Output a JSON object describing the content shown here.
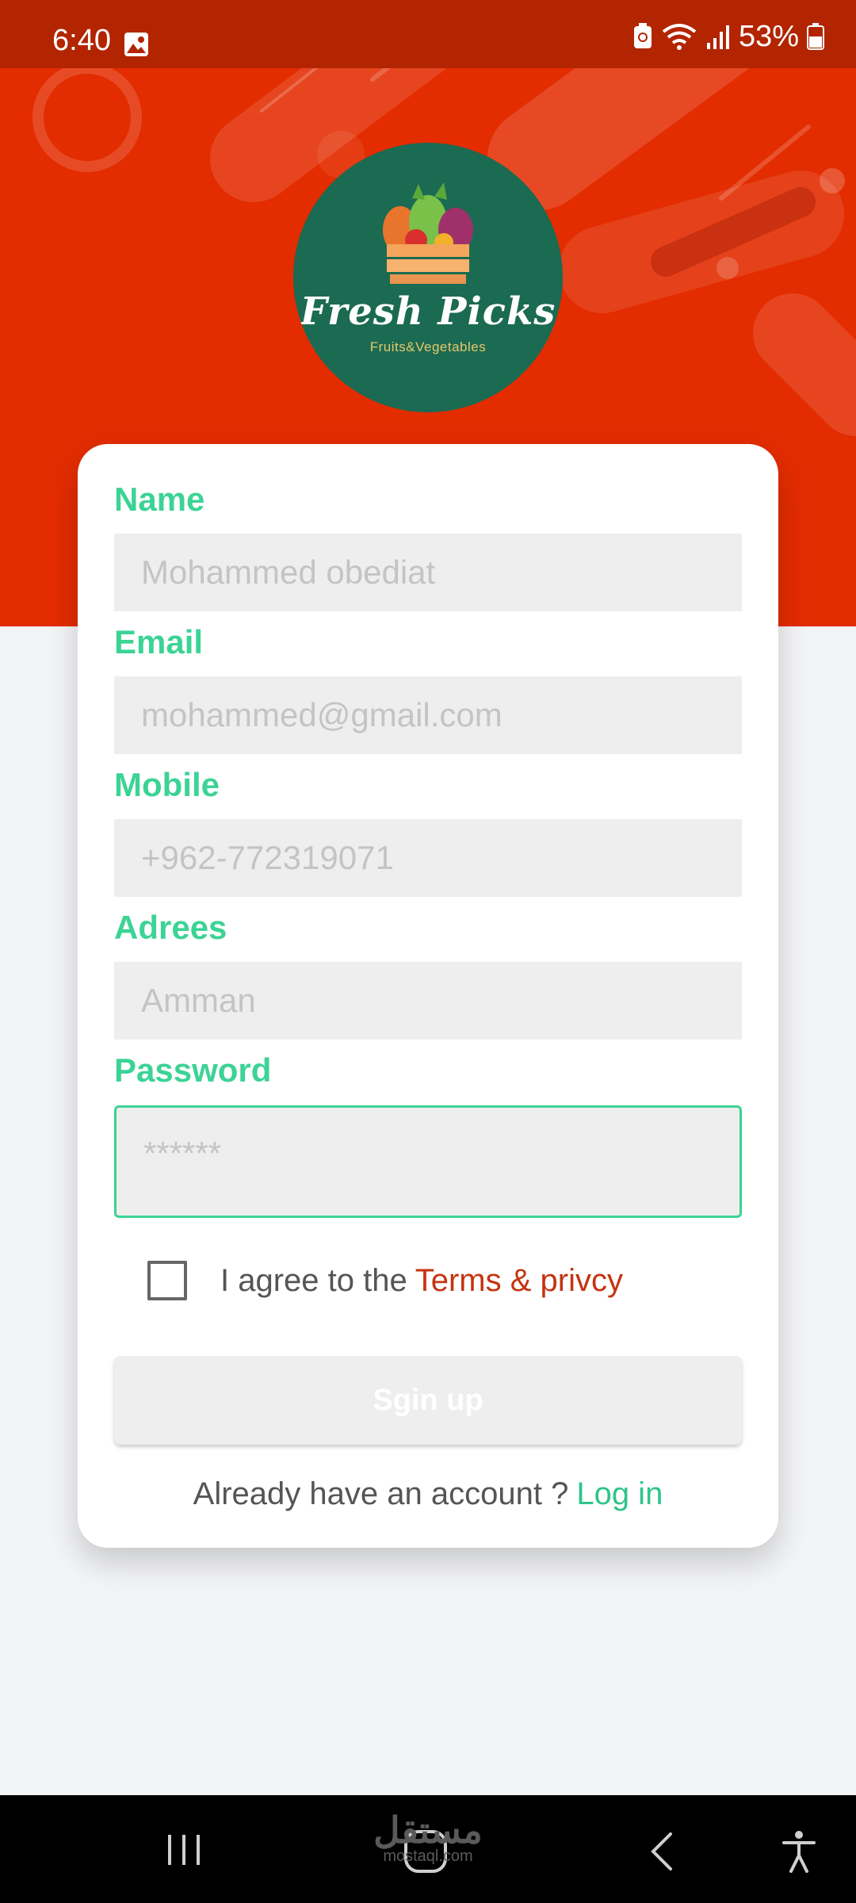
{
  "status_bar": {
    "time": "6:40",
    "battery": "53%",
    "icons": [
      "gallery-icon",
      "battery-saver-icon",
      "wifi-icon",
      "signal-icon",
      "battery-icon"
    ]
  },
  "logo": {
    "title": "Fresh Picks",
    "subtitle": "Fruits&Vegetables"
  },
  "form": {
    "name": {
      "label": "Name",
      "placeholder": "Mohammed obediat"
    },
    "email": {
      "label": "Email",
      "placeholder": "mohammed@gmail.com"
    },
    "mobile": {
      "label": "Mobile",
      "placeholder": "+962-772319071"
    },
    "address": {
      "label": "Adrees",
      "placeholder": "Amman"
    },
    "password": {
      "label": "Password",
      "placeholder": "******"
    },
    "agree_text": "I agree to the",
    "terms_link": "Terms & privcy",
    "signup_button": "Sgin up",
    "login_prompt": "Already have an account ?",
    "login_link": "Log in"
  },
  "watermark": {
    "brand": "مستقل",
    "domain": "mostaql.com"
  },
  "nav_bar": {
    "icons": [
      "recent-apps-icon",
      "home-icon",
      "back-icon",
      "accessibility-icon"
    ]
  },
  "colors": {
    "hero": "#e32c00",
    "status_bar": "#b22500",
    "accent_green": "#3cd395",
    "terms_red": "#c43410",
    "logo_bg": "#1b6a52"
  }
}
